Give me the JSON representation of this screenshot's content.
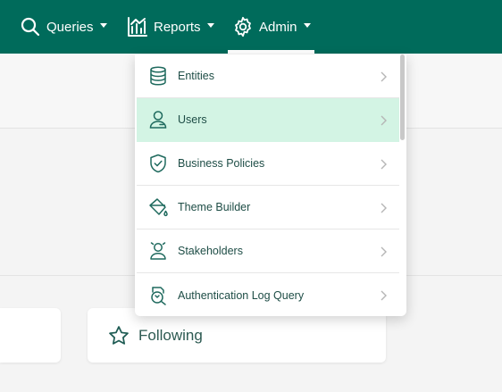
{
  "nav": {
    "queries": {
      "label": "Queries",
      "icon": "search-icon"
    },
    "reports": {
      "label": "Reports",
      "icon": "bar-chart-icon"
    },
    "admin": {
      "label": "Admin",
      "icon": "gear-icon"
    }
  },
  "colors": {
    "brand": "#006b5b",
    "active_item_bg": "#d3f4e4",
    "icon": "#1f6a5e"
  },
  "admin_menu": {
    "items": [
      {
        "label": "Entities",
        "icon": "database-icon",
        "active": false
      },
      {
        "label": "Users",
        "icon": "user-icon",
        "active": true
      },
      {
        "label": "Business Policies",
        "icon": "shield-check-icon",
        "active": false
      },
      {
        "label": "Theme Builder",
        "icon": "paint-bucket-icon",
        "active": false
      },
      {
        "label": "Stakeholders",
        "icon": "stakeholder-icon",
        "active": false
      },
      {
        "label": "Authentication Log Query",
        "icon": "search-document-icon",
        "active": false
      }
    ]
  },
  "cards": {
    "following": {
      "label": "Following",
      "icon": "star-icon"
    }
  }
}
